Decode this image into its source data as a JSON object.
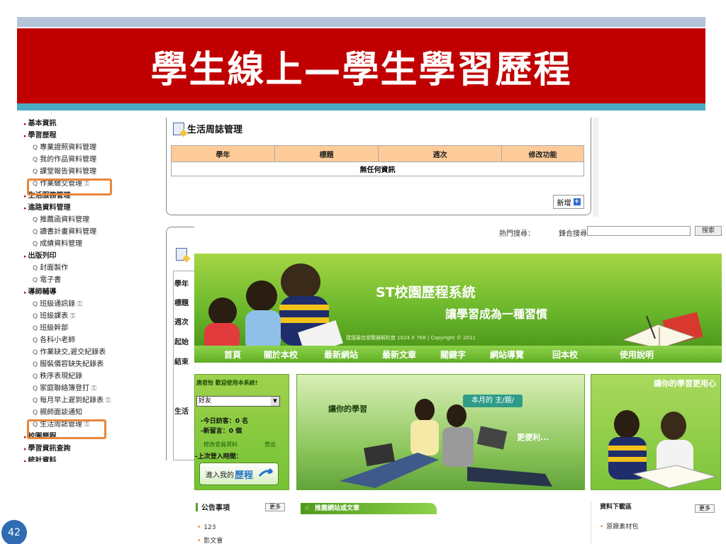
{
  "slide": {
    "title": "學生線上—學生學習歷程",
    "page_number": "42"
  },
  "sidebar": {
    "items": [
      {
        "type": "cat",
        "label": "基本資訊"
      },
      {
        "type": "cat",
        "label": "學習歷程"
      },
      {
        "type": "item",
        "label": "專業證照資料管理",
        "lock": false
      },
      {
        "type": "item",
        "label": "我的作品資料管理",
        "lock": false
      },
      {
        "type": "item",
        "label": "課堂報告資料管理",
        "lock": false
      },
      {
        "type": "item",
        "label": "作業繳交管理",
        "lock": true
      },
      {
        "type": "cat",
        "label": "生活服務管理"
      },
      {
        "type": "cat",
        "label": "進路資料管理"
      },
      {
        "type": "item",
        "label": "推薦函資料管理",
        "lock": false
      },
      {
        "type": "item",
        "label": "讀書計畫資料管理",
        "lock": false
      },
      {
        "type": "item",
        "label": "成績資料管理",
        "lock": false
      },
      {
        "type": "cat",
        "label": "出版列印"
      },
      {
        "type": "item",
        "label": "封面製作",
        "lock": false
      },
      {
        "type": "item",
        "label": "電子書",
        "lock": false
      },
      {
        "type": "cat",
        "label": "導師輔導"
      },
      {
        "type": "item",
        "label": "班級通訊錄",
        "lock": true
      },
      {
        "type": "item",
        "label": "班級課表",
        "lock": true
      },
      {
        "type": "item",
        "label": "班級幹部",
        "lock": false
      },
      {
        "type": "item",
        "label": "各科小老師",
        "lock": false
      },
      {
        "type": "item",
        "label": "作業缺交,遲交紀錄表",
        "lock": false
      },
      {
        "type": "item",
        "label": "服裝儀容缺失紀錄表",
        "lock": false
      },
      {
        "type": "item",
        "label": "秩序表現紀錄",
        "lock": false
      },
      {
        "type": "item",
        "label": "家庭聯絡簿登打",
        "lock": true
      },
      {
        "type": "item",
        "label": "每月早上遲到紀錄表",
        "lock": true
      },
      {
        "type": "item",
        "label": "親師面談通知",
        "lock": false
      },
      {
        "type": "item",
        "label": "生活周誌管理",
        "lock": true
      },
      {
        "type": "cat",
        "label": "校園歷程"
      },
      {
        "type": "cat",
        "label": "學習資訊查詢"
      },
      {
        "type": "cat",
        "label": "統計資料"
      }
    ]
  },
  "journal": {
    "title": "生活周誌管理",
    "headers": [
      "學年",
      "標題",
      "週次",
      "修改功能"
    ],
    "empty": "無任何資訊",
    "add_label": "新增",
    "row_labels": [
      "學年",
      "標題",
      "週次",
      "起始",
      "結束",
      "生活"
    ]
  },
  "site": {
    "hot_search_label": "熱門搜尋：",
    "site_search_label": "鋒合搜尋",
    "search_button": "搜索",
    "banner_title": "ST校園歷程系統",
    "banner_subtitle": "讓學習成為一種習慣",
    "banner_note": "建議最佳瀏覽器解析度 1024 X 768 | Copyright © 2011",
    "nav": [
      "首頁",
      "關於本校",
      "最新網站",
      "最新文章",
      "關鍵字",
      "網站導覽",
      "回本校",
      "使用說明"
    ],
    "welcome": "唐君怡 歡迎使用本系統!",
    "friend_select": "好友",
    "visitors_today": "-今日訪客：0 名",
    "new_messages": "-新留言：0 個",
    "edit_member": "修改會員資料",
    "logout": "登出",
    "last_login": "-上次登入時間：",
    "enter_prefix": "進入我的",
    "enter_strong": "歷程",
    "photo_text1": "讓你的學習",
    "photo_text2": "更便利...",
    "theme_tab": "本月的 主/題/",
    "right_title": "讓你的學習更用心",
    "notice_title": "公告事項",
    "more": "更多",
    "notice_items": [
      "123",
      "影文會"
    ],
    "recommend_title": "推薦網站或文章",
    "download_title": "資料下載區",
    "download_items": [
      "原廠素材包"
    ]
  }
}
